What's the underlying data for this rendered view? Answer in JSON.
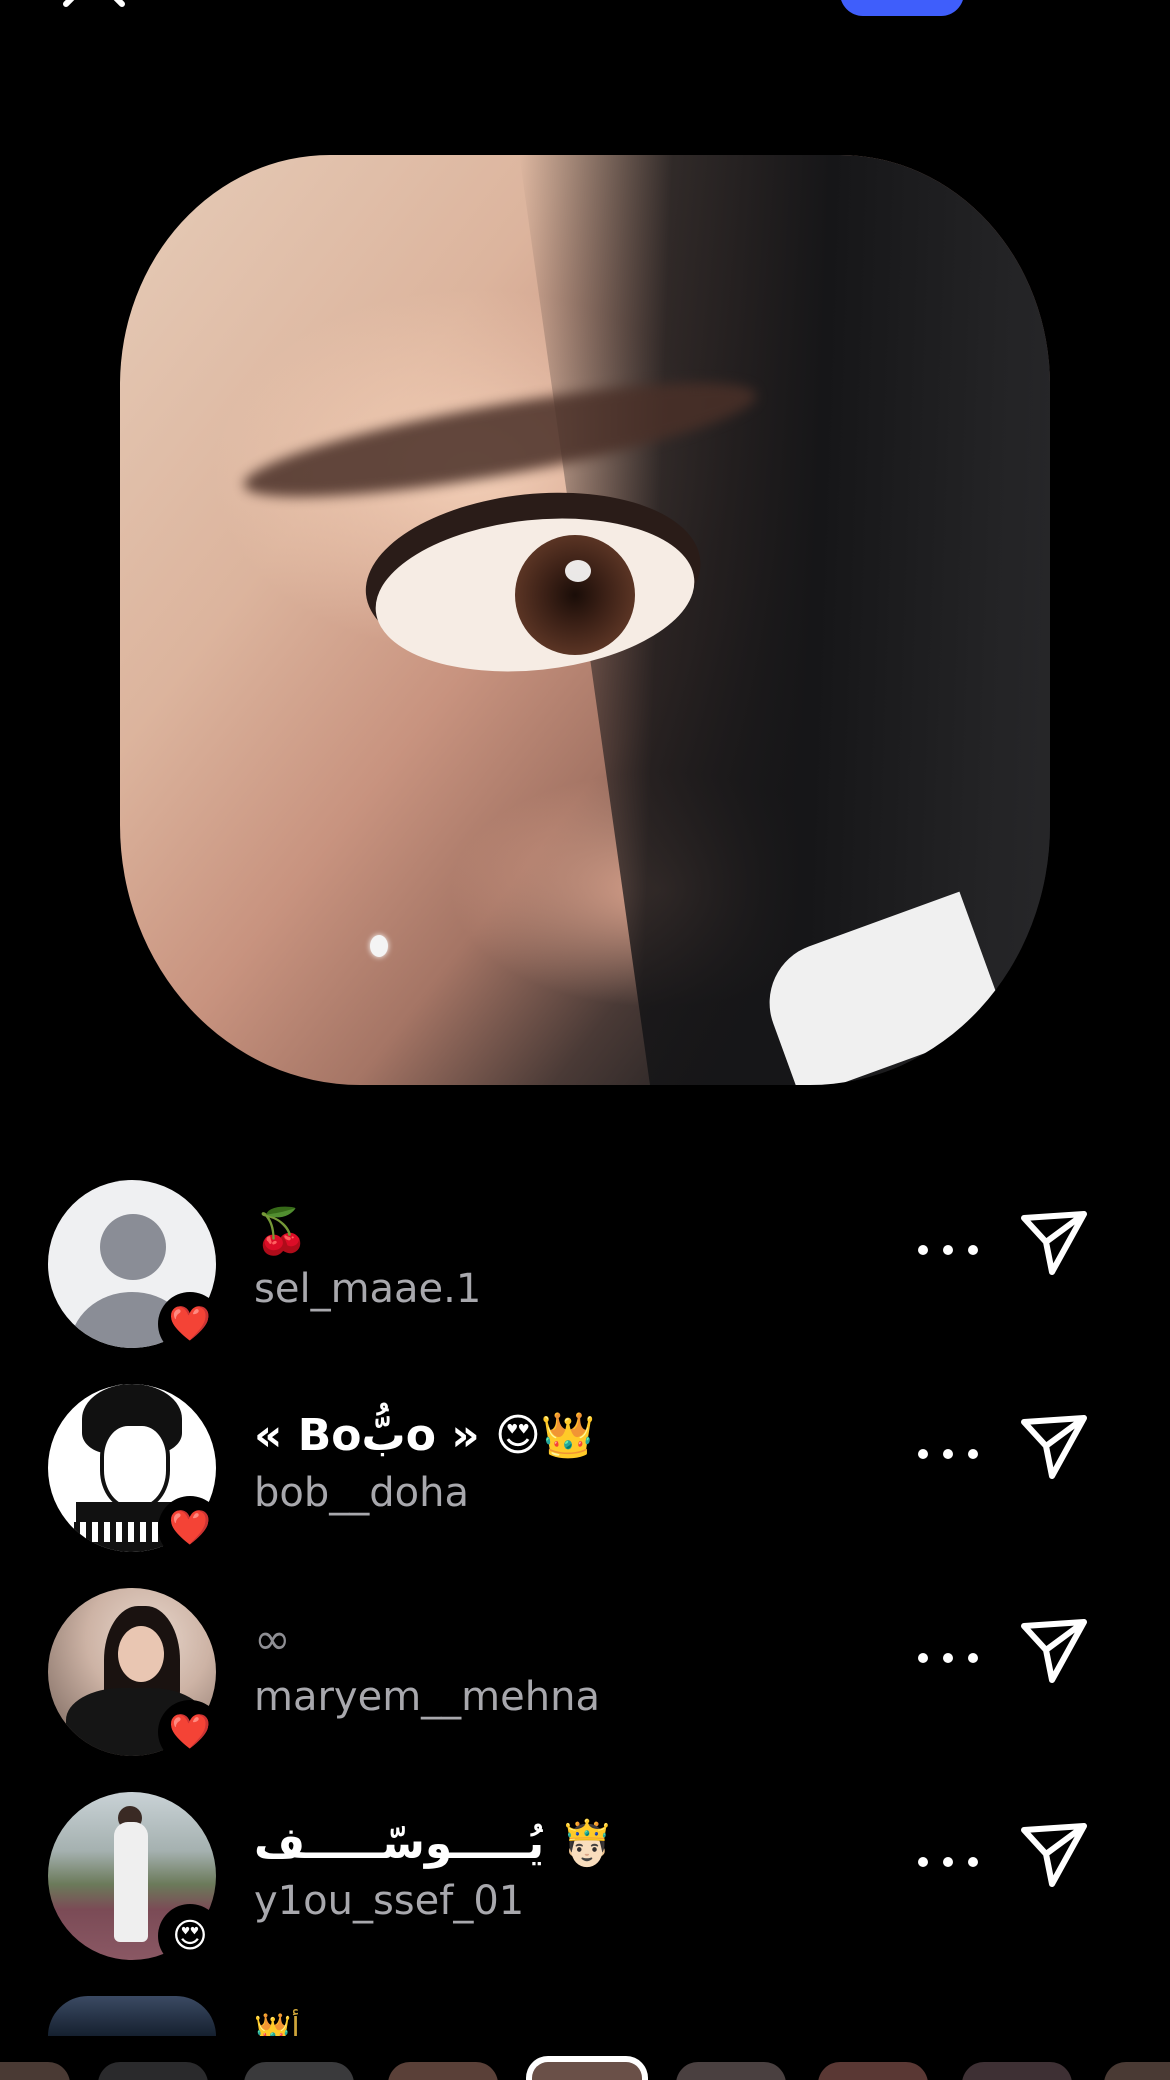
{
  "header": {
    "close_icon": "close-icon",
    "accent_color": "#3f5efb"
  },
  "viewers": [
    {
      "display_name": "🍒",
      "username": "sel_maae.1",
      "reaction": "❤️",
      "avatar": "default-avatar"
    },
    {
      "display_name": "« Boبُّo » 😍👑",
      "username": "bob__doha",
      "reaction": "❤️",
      "avatar": "sketch-avatar"
    },
    {
      "display_name": "∞",
      "username": "maryem__mehna",
      "reaction": "❤️",
      "avatar": "photo-avatar"
    },
    {
      "display_name": "يُـــــوسّـــــف 🤴🏻",
      "username": "y1ou_ssef_01",
      "reaction": "😍",
      "avatar": "photo-avatar"
    }
  ],
  "partial_viewer": {
    "display_name": "👑أ"
  },
  "icons": {
    "more": "more-icon",
    "send": "send-icon"
  }
}
